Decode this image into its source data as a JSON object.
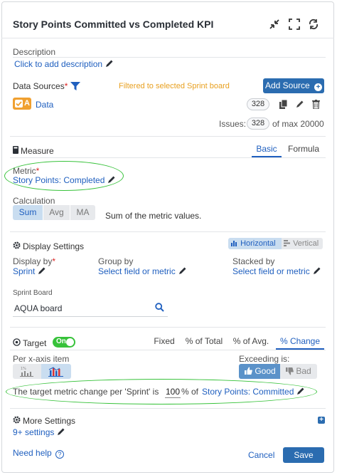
{
  "title": "Story Points Committed vs Completed KPI",
  "description": {
    "label": "Description",
    "link": "Click to add description"
  },
  "data_sources": {
    "label": "Data Sources",
    "required_mark": "*",
    "filter_note": "Filtered to selected Sprint board",
    "add_button": "Add Source",
    "source_name": "Data",
    "source_letter": "A",
    "count": "328",
    "issues_label": "Issues:",
    "issues_count": "328",
    "issues_max": "of max 20000"
  },
  "measure": {
    "label": "Measure",
    "tabs": [
      "Basic",
      "Formula"
    ],
    "metric_label": "Metric",
    "metric_required": "*",
    "metric_value": "Story Points: Completed",
    "calculation_label": "Calculation",
    "calc_options": [
      "Sum",
      "Avg",
      "MA"
    ],
    "calc_description": "Sum of the metric values."
  },
  "display_settings": {
    "label": "Display Settings",
    "orientation": [
      "Horizontal",
      "Vertical"
    ],
    "display_by_label": "Display by",
    "display_by_required": "*",
    "display_by_value": "Sprint",
    "group_by_label": "Group by",
    "group_by_value": "Select field or metric",
    "stacked_by_label": "Stacked by",
    "stacked_by_value": "Select field or metric",
    "sprint_board_label": "Sprint Board",
    "sprint_board_value": "AQUA board"
  },
  "target": {
    "label": "Target",
    "toggle": "On",
    "tabs": [
      "Fixed",
      "% of Total",
      "% of Avg.",
      "% Change"
    ],
    "per_x_label": "Per x-axis item",
    "exceeding_label": "Exceeding is:",
    "good": "Good",
    "bad": "Bad",
    "sentence_prefix": "The target metric change per 'Sprint' is",
    "value": "100",
    "sentence_mid": "% of",
    "target_metric": "Story Points: Committed"
  },
  "more_settings": {
    "label": "More Settings",
    "link": "9+ settings"
  },
  "footer": {
    "help": "Need help",
    "cancel": "Cancel",
    "save": "Save"
  },
  "colors": {
    "accent": "#2b6cb0",
    "link": "#1f5fbf",
    "orange": "#f0a030",
    "green": "#37c23a",
    "filter_note": "#e8a020"
  }
}
